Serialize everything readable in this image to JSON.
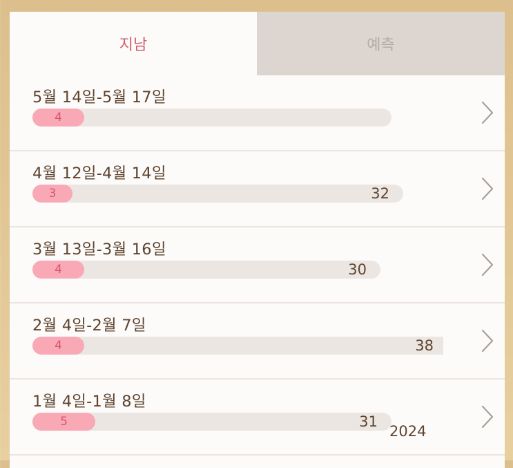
{
  "tabs": {
    "past": "지남",
    "forecast": "예측"
  },
  "cycles": [
    {
      "range": "5월 14일-5월 17일",
      "period_days": "4",
      "cycle_days": ""
    },
    {
      "range": "4월 12일-4월 14일",
      "period_days": "3",
      "cycle_days": "32"
    },
    {
      "range": "3월 13일-3월 16일",
      "period_days": "4",
      "cycle_days": "30"
    },
    {
      "range": "2월 4일-2월 7일",
      "period_days": "4",
      "cycle_days": "38"
    },
    {
      "range": "1월 4일-1월 8일",
      "period_days": "5",
      "cycle_days": "31"
    }
  ],
  "year_label": "2024",
  "colors": {
    "active_tab_text": "#d25e6e",
    "period_fill": "#f9a9b6",
    "track": "#ebe6e1",
    "text": "#5e4430"
  },
  "icons": {
    "row_arrow": "chevron-right-icon"
  }
}
